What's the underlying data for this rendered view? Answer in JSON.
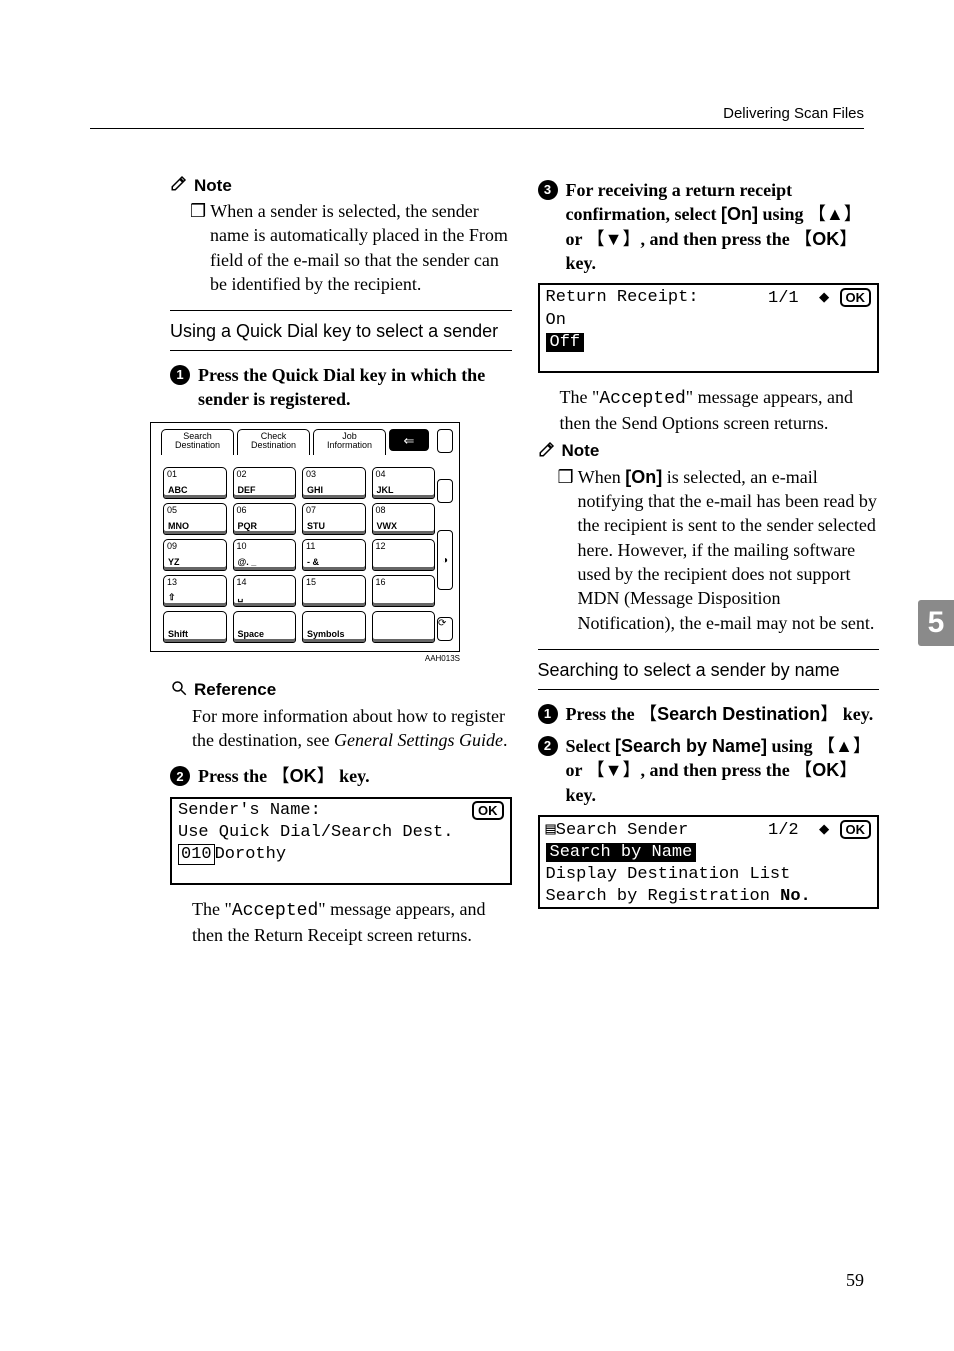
{
  "header": {
    "title": "Delivering Scan Files"
  },
  "left": {
    "note_label": "Note",
    "note_body": "❒ When a sender is selected, the sender name is automatically placed in the From field of the e-mail so that the sender can be identified by the recipient.",
    "sub1": "Using a Quick Dial key to select a sender",
    "step1": "Press the Quick Dial key in which the sender is registered.",
    "pad": {
      "tabs": [
        "Search\nDestination",
        "Check\nDestination",
        "Job\nInformation"
      ],
      "arrow": "⇐",
      "keys": [
        [
          "01|ABC",
          "02|DEF",
          "03|GHI",
          "04|JKL"
        ],
        [
          "05|MNO",
          "06|PQR",
          "07|STU",
          "08|VWX"
        ],
        [
          "09|YZ",
          "10|@. _",
          "11|- &",
          "12|"
        ],
        [
          "13|⇧",
          "14|␣",
          "15|",
          "16|"
        ]
      ],
      "bottom": [
        "Shift",
        "Space",
        "Symbols",
        ""
      ],
      "code": "AAH013S"
    },
    "ref_label": "Reference",
    "ref_body_a": "For more information about how to register the destination, see ",
    "ref_body_em": "General Settings Guide",
    "ref_body_b": ".",
    "step2_a": "Press the ",
    "step2_key": "OK",
    "step2_b": " key.",
    "lcd1": {
      "l1_a": "Sender's Name:",
      "l1_b": "OK",
      "l2": "Use Quick Dial/Search Dest.",
      "l3_num": "010",
      "l3_name": "Dorothy"
    },
    "after1_a": "The \"",
    "after1_mono": "Accepted",
    "after1_b": "\" message appears, and then the Return Receipt screen returns."
  },
  "right": {
    "step3_a": "For receiving a return receipt confirmation, select ",
    "step3_on": "[On]",
    "step3_b": " using ",
    "step3_up": "▲",
    "step3_c": " or ",
    "step3_dn": "▼",
    "step3_d": ", and then press the ",
    "step3_ok": "OK",
    "step3_e": " key.",
    "lcd2": {
      "l1_a": "Return Receipt:",
      "l1_b": "1/1",
      "l1_c": "OK",
      "l2": "On",
      "l3": "Off"
    },
    "after2_a": "The \"",
    "after2_mono": "Accepted",
    "after2_b": "\" message appears, and then the Send Options screen returns.",
    "note2_label": "Note",
    "note2_body_a": "❒ When ",
    "note2_on": "[On]",
    "note2_body_b": " is selected, an e-mail notifying that the e-mail has been read by the recipient is sent to the sender selected here. However, if the mailing software used by the recipient does not support MDN (Message Disposition Notification), the e-mail may not be sent.",
    "sub2": "Searching to select a sender by name",
    "r_step1_a": "Press the ",
    "r_step1_key": "Search Destination",
    "r_step1_b": " key.",
    "r_step2_a": "Select ",
    "r_step2_opt": "[Search by Name]",
    "r_step2_b": " using ",
    "r_step2_up": "▲",
    "r_step2_c": " or ",
    "r_step2_dn": "▼",
    "r_step2_d": ", and then press the ",
    "r_step2_ok": "OK",
    "r_step2_e": " key.",
    "lcd3": {
      "l1_a": "Search Sender",
      "l1_b": "1/2",
      "l1_c": "OK",
      "l2": "Search by Name",
      "l3": "Display Destination List",
      "l4_a": "Search by Registration ",
      "l4_b": "No."
    }
  },
  "chapter_tab": "5",
  "page_number": "59"
}
